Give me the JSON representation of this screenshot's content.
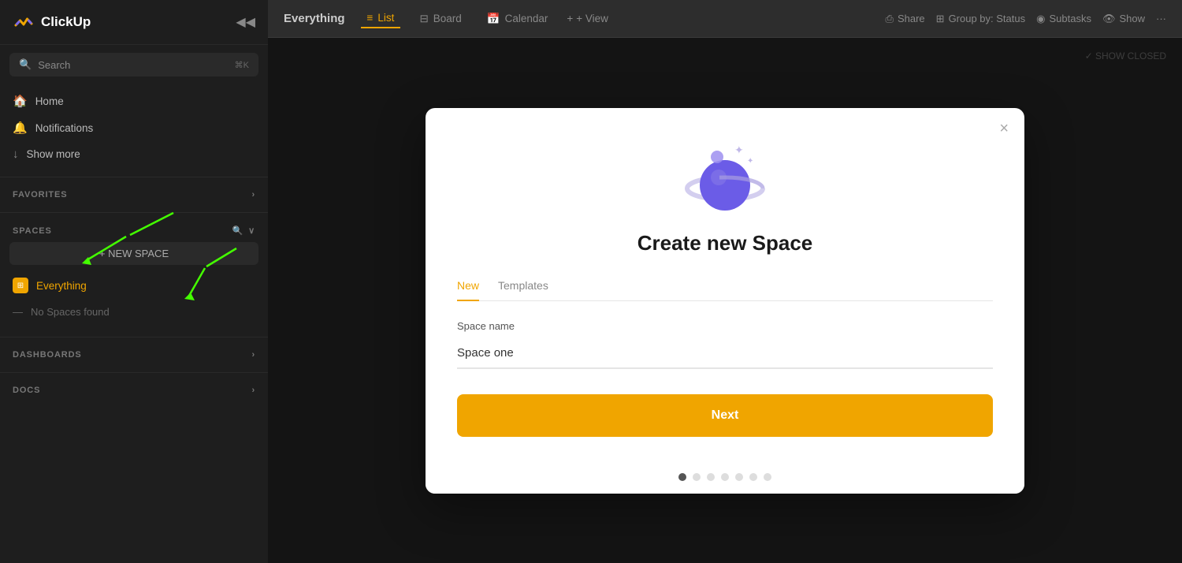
{
  "sidebar": {
    "logo_text": "ClickUp",
    "collapse_icon": "◀◀",
    "search": {
      "placeholder": "Search",
      "shortcut": "⌘K"
    },
    "nav_items": [
      {
        "label": "Home",
        "icon": "🏠"
      },
      {
        "label": "Notifications",
        "icon": "🔔"
      },
      {
        "label": "Show more",
        "icon": "↓"
      }
    ],
    "sections": [
      {
        "title": "FAVORITES",
        "expand_icon": "›"
      },
      {
        "title": "SPACES",
        "search_icon": "🔍",
        "expand_icon": "∨"
      }
    ],
    "new_space_label": "+ NEW SPACE",
    "space_items": [
      {
        "label": "Everything",
        "icon": "⊞"
      }
    ],
    "no_spaces_label": "No Spaces found",
    "bottom_sections": [
      {
        "title": "DASHBOARDS",
        "expand_icon": "›"
      },
      {
        "title": "DOCS",
        "expand_icon": "›"
      }
    ]
  },
  "topbar": {
    "title": "Everything",
    "tabs": [
      {
        "label": "List",
        "icon": "≡",
        "active": true
      },
      {
        "label": "Board",
        "icon": "⊟",
        "active": false
      },
      {
        "label": "Calendar",
        "icon": "📅",
        "active": false
      }
    ],
    "add_view_label": "+ View",
    "right_buttons": [
      {
        "label": "Share",
        "icon": "⎙"
      },
      {
        "label": "Group by: Status",
        "icon": "⊞"
      },
      {
        "label": "Subtasks",
        "icon": "◉"
      },
      {
        "label": "Show",
        "icon": "👁"
      },
      {
        "label": "···",
        "icon": ""
      }
    ]
  },
  "content": {
    "show_closed_label": "✓ SHOW CLOSED"
  },
  "modal": {
    "title": "Create new Space",
    "close_icon": "×",
    "tabs": [
      {
        "label": "New",
        "active": true
      },
      {
        "label": "Templates",
        "active": false
      }
    ],
    "field": {
      "label": "Space name",
      "value": "Space one",
      "placeholder": "Space name"
    },
    "next_button": "Next",
    "dots": [
      {
        "active": true
      },
      {
        "active": false
      },
      {
        "active": false
      },
      {
        "active": false
      },
      {
        "active": false
      },
      {
        "active": false
      },
      {
        "active": false
      }
    ]
  }
}
